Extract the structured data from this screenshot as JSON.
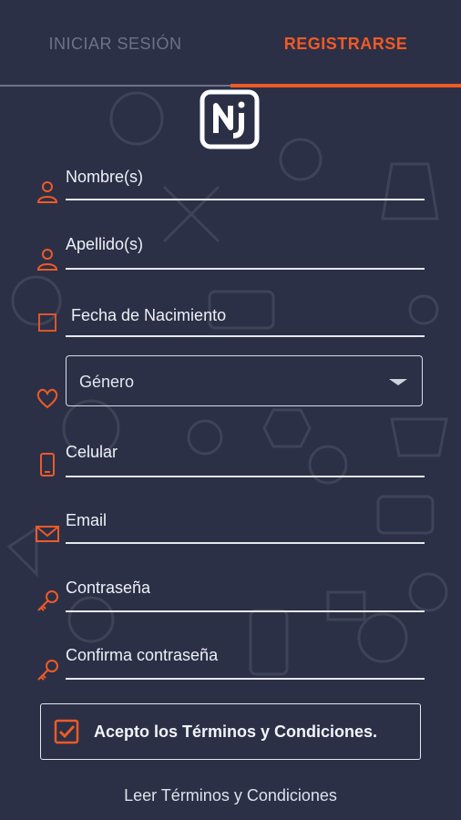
{
  "tabs": {
    "login_label": "INICIAR SESIÓN",
    "register_label": "REGISTRARSE",
    "active": "register"
  },
  "colors": {
    "background": "#2b3047",
    "accent": "#ef5a26",
    "text": "#eef0f5",
    "muted": "#6c7288"
  },
  "logo": {
    "text": "NJ",
    "icon": "nj-logo"
  },
  "form": {
    "first_name": {
      "label": "Nombre(s)",
      "icon": "user-icon"
    },
    "last_name": {
      "label": "Apellido(s)",
      "icon": "user-icon"
    },
    "birth_date": {
      "label": "Fecha de Nacimiento",
      "icon": "calendar-icon"
    },
    "gender": {
      "label": "Género",
      "icon": "heart-icon"
    },
    "phone": {
      "label": "Celular",
      "icon": "phone-icon"
    },
    "email": {
      "label": "Email",
      "icon": "envelope-icon"
    },
    "password": {
      "label": "Contraseña",
      "icon": "key-icon"
    },
    "confirm_password": {
      "label": "Confirma contraseña",
      "icon": "key-icon"
    }
  },
  "terms": {
    "checkbox_label": "Acepto los Términos y Condiciones.",
    "checked": true,
    "read_link": "Leer Términos y Condiciones"
  }
}
